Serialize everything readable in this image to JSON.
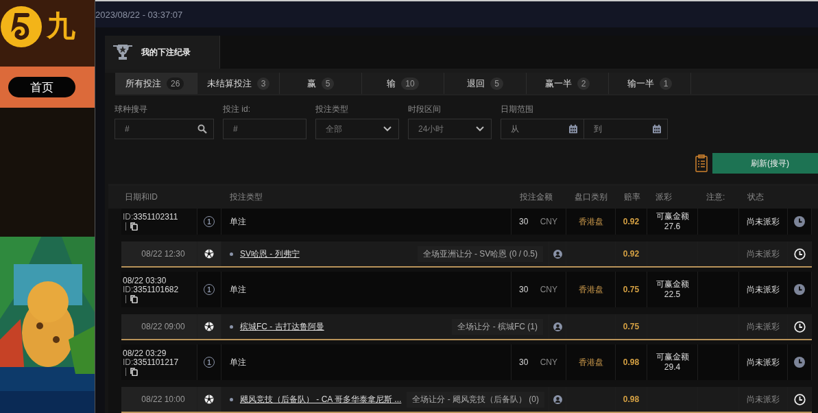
{
  "sidebar": {
    "logo_text": "九",
    "home_button": "首页"
  },
  "topbar": {
    "datetime": "2023/08/22 - 03:37:07"
  },
  "dialog": {
    "title": "我的下注纪录",
    "tabs": [
      {
        "label": "所有投注",
        "count": "26",
        "selected": true
      },
      {
        "label": "未结算投注",
        "count": "3",
        "selected": false
      },
      {
        "label": "赢",
        "count": "5",
        "selected": false
      },
      {
        "label": "输",
        "count": "10",
        "selected": false
      },
      {
        "label": "退回",
        "count": "5",
        "selected": false
      },
      {
        "label": "赢一半",
        "count": "2",
        "selected": false
      },
      {
        "label": "输一半",
        "count": "1",
        "selected": false
      }
    ],
    "filters": [
      {
        "kind": "search",
        "label": "球种搜寻",
        "placeholder": "#"
      },
      {
        "kind": "text",
        "label": "投注 id:",
        "placeholder": "#"
      },
      {
        "kind": "select",
        "label": "投注类型",
        "value": "全部"
      },
      {
        "kind": "select",
        "label": "时段区间",
        "value": "24小时"
      },
      {
        "kind": "daterange",
        "label": "日期范围",
        "from_placeholder": "从",
        "to_placeholder": "到"
      }
    ],
    "refresh_button": "刷新(搜寻)",
    "table": {
      "columns": [
        "日期和ID",
        "投注类型",
        "投注金额",
        "盘口类别",
        "赔率",
        "派彩",
        "注意:",
        "状态"
      ],
      "rows": [
        {
          "kind": "bet",
          "id_prefix": "ID:",
          "id": "3351102311",
          "legs": "1",
          "bet_type": "单注",
          "amount": "30",
          "currency": "CNY",
          "market": "香港盘",
          "odds": "0.92",
          "payout_label": "可赢金额",
          "payout": "27.6",
          "status": "尚未派彩"
        },
        {
          "kind": "match",
          "time": "08/22 12:30",
          "match": "SV哈恩 - 列弗宁",
          "pick": "全场亚洲让分 - SV哈恩 (0 / 0.5)",
          "odds": "0.92",
          "status": "尚未派彩"
        },
        {
          "kind": "bet",
          "date": "08/22 03:30",
          "id_prefix": "ID:",
          "id": "3351101682",
          "legs": "1",
          "bet_type": "单注",
          "amount": "30",
          "currency": "CNY",
          "market": "香港盘",
          "odds": "0.75",
          "payout_label": "可赢金额",
          "payout": "22.5",
          "status": "尚未派彩"
        },
        {
          "kind": "match",
          "time": "08/22 09:00",
          "match": "槟城FC - 吉打达鲁阿曼",
          "pick": "全场让分 - 槟城FC (1)",
          "odds": "0.75",
          "status": "尚未派彩"
        },
        {
          "kind": "bet",
          "date": "08/22 03:29",
          "id_prefix": "ID:",
          "id": "3351101217",
          "legs": "1",
          "bet_type": "单注",
          "amount": "30",
          "currency": "CNY",
          "market": "香港盘",
          "odds": "0.98",
          "payout_label": "可赢金额",
          "payout": "29.4",
          "status": "尚未派彩"
        },
        {
          "kind": "match",
          "time": "08/22 10:00",
          "match": "飓风竞技（后备队） - CA 哥多华泰拿尼斯 ...",
          "pick": "全场让分 - 飓风竞技（后备队） (0)",
          "odds": "0.98",
          "status": "尚未派彩"
        }
      ]
    }
  }
}
